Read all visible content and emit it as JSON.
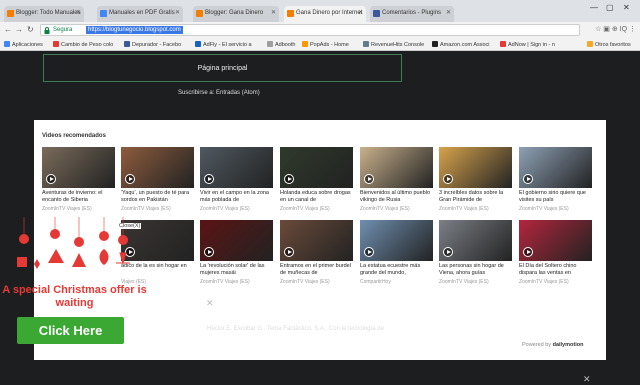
{
  "browser": {
    "tabs": [
      {
        "label": "Blogger: Todo Manuales",
        "color": "#f57d00"
      },
      {
        "label": "Manuales en PDF Gratis",
        "color": "#4285f4"
      },
      {
        "label": "Blogger: Gana Dinero",
        "color": "#f57d00"
      },
      {
        "label": "Gana Dinero por Internet",
        "color": "#f57d00"
      },
      {
        "label": "Comentarios - Plugins",
        "color": "#3b5998"
      }
    ],
    "active_tab": 3,
    "secure_label": "Segura",
    "url": "https://blogtunegocio.blogspot.com"
  },
  "bookmarks": [
    "Aplicaciones",
    "Cambio de Peso colo",
    "Depurador - Facebo",
    "AdFly - El servicio a",
    "Adbooth",
    "PopAds - Home",
    "RevenueHits Console",
    "Amazon.com Associ",
    "AdNow | Sign in - n",
    "Otros favoritos"
  ],
  "page": {
    "home_button": "Página principal",
    "subscribe": "Suscribirse a: Entradas (Atom)",
    "videos_title": "Videos recomendados",
    "videos": [
      {
        "title": "Aventuras de invierno: el encanto de Siberia",
        "source": "ZoomInTV Viajes (ES)",
        "color": "#7a6b5b"
      },
      {
        "title": "'Yaqu', un puesto de té para sordos en Pakistán",
        "source": "ZoomInTV Viajes (ES)",
        "color": "#8e5c3e"
      },
      {
        "title": "Vivir en el campo en la zona más poblada de",
        "source": "ZoomInTV Viajes (ES)",
        "color": "#4f5961"
      },
      {
        "title": "Holanda educa sobre drogas en un canal de",
        "source": "ZoomInTV Viajes (ES)",
        "color": "#2f3a2b"
      },
      {
        "title": "Bienvenidos al último pueblo vikingo de Rusia",
        "source": "ZoomInTV Viajes (ES)",
        "color": "#c9b18c"
      },
      {
        "title": "3 increíbles datos sobre la Gran Pirámide de",
        "source": "ZoomInTV Viajes (ES)",
        "color": "#d7a34c"
      },
      {
        "title": "El gobierno sirio quiere que visites su país",
        "source": "ZoomInTV Viajes (ES)",
        "color": "#8ea1b5"
      },
      {
        "title": "ádico de la es sin hogar en",
        "source": "Viajes (ES)",
        "color": "#3a3533"
      },
      {
        "title": "La 'revolución solar' de las mujeres masái",
        "source": "ZoomInTV Viajes (ES)",
        "color": "#5b1414"
      },
      {
        "title": "Entramos en el primer burdel de muñecas de",
        "source": "ZoomInTV Viajes (ES)",
        "color": "#6a4a3a"
      },
      {
        "title": "La estatua ecuestre más grande del mundo,",
        "source": "CompartirHoy",
        "color": "#6f8fb0"
      },
      {
        "title": "Las personas sin hogar de Viena, ahora guías",
        "source": "ZoomInTV Viajes (ES)",
        "color": "#7b7f86"
      },
      {
        "title": "El Día del Soltero chino dispara las ventas en",
        "source": "ZoomInTV Viajes (ES)",
        "color": "#b3263c"
      }
    ],
    "powered_by": "Powered by",
    "powered_brand": "dailymotion",
    "footer": "Héctor E. Escobar G.. Tema Fantástico, S.A.. Con la tecnología de"
  },
  "promo": {
    "close_label": "Close(X)",
    "text": "A special Christmas offer is waiting",
    "button": "Click Here",
    "accent": "#e53935",
    "button_color": "#3aa833"
  }
}
